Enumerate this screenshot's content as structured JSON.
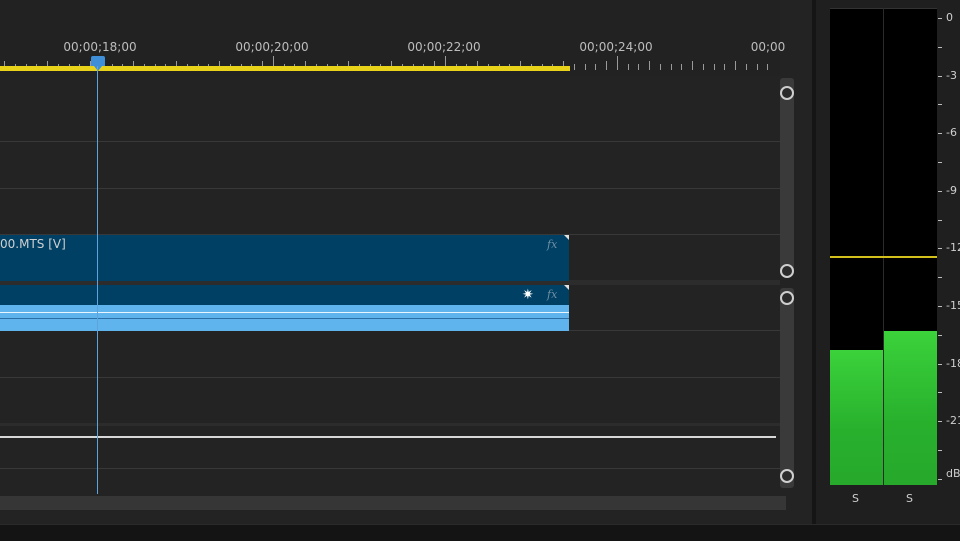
{
  "ruler": {
    "timecodes": [
      "00;00;18;00",
      "00;00;20;00",
      "00;00;22;00",
      "00;00;24;00",
      "00;00"
    ]
  },
  "tracks": {
    "video_clip_name": "00.MTS [V]",
    "fx_label": "fx",
    "audio_fx_label": "fx",
    "audio_effect_icon": "burst-icon"
  },
  "meter": {
    "scale": [
      "0",
      "-3",
      "-6",
      "-9",
      "-12",
      "-15",
      "-18",
      "-21",
      "dB"
    ],
    "channels": [
      "S",
      "S"
    ],
    "levels": {
      "left_db": -17.3,
      "right_db": -16.3,
      "peak_db": -12.3
    },
    "bar_color": "#3bd23b",
    "peak_color": "#d4c01a"
  },
  "colors": {
    "clip": "#004064",
    "waveform": "#5fb4ee",
    "playhead": "#3e8fd8",
    "work_area": "#e8d21a"
  }
}
